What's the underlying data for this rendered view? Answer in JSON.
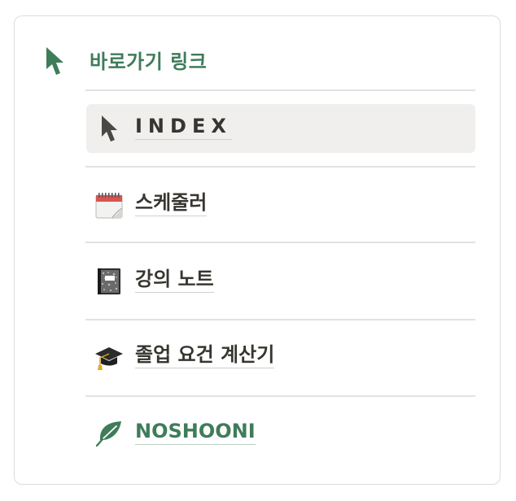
{
  "header": {
    "title": "바로가기 링크",
    "icon": "cursor-arrow-icon",
    "color": "#3f7c5a"
  },
  "items": [
    {
      "label": "INDEX",
      "icon": "cursor-arrow-icon",
      "active": true
    },
    {
      "label": "스케줄러",
      "icon": "calendar-icon"
    },
    {
      "label": "강의 노트",
      "icon": "notebook-icon"
    },
    {
      "label": "졸업 요건 계산기",
      "icon": "graduation-cap-icon"
    },
    {
      "label": "NOSHOONI",
      "icon": "leaf-icon",
      "color": "#3f7c5a"
    }
  ]
}
